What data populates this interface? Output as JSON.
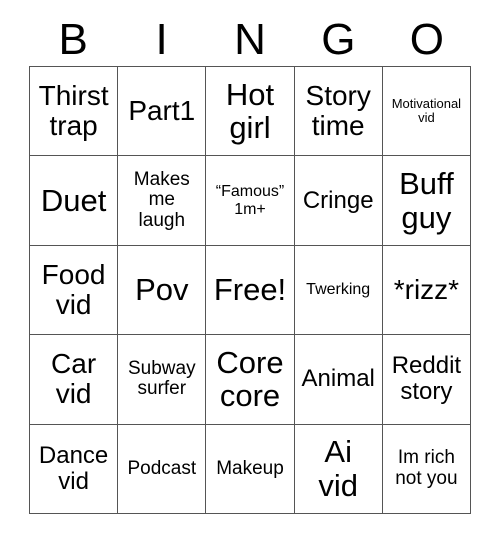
{
  "card": {
    "title": "BINGO",
    "header": {
      "letters": [
        "B",
        "I",
        "N",
        "G",
        "O"
      ]
    },
    "colors": {
      "background": "#ffffff",
      "text": "#000000",
      "gridline": "#555555"
    },
    "grid": {
      "rows": 5,
      "columns": 5,
      "free_space": {
        "row": 3,
        "column": 3,
        "label": "Free!"
      },
      "cells": [
        [
          {
            "label": "Thirst\ntrap",
            "size": "lg"
          },
          {
            "label": "Part1",
            "size": "lg"
          },
          {
            "label": "Hot\ngirl",
            "size": "xl"
          },
          {
            "label": "Story\ntime",
            "size": "lg"
          },
          {
            "label": "Motivational\nvid",
            "size": "xxs"
          }
        ],
        [
          {
            "label": "Duet",
            "size": "xl"
          },
          {
            "label": "Makes\nme\nlaugh",
            "size": "sm"
          },
          {
            "label": "“Famous”\n1m+",
            "size": "xs"
          },
          {
            "label": "Cringe",
            "size": "md"
          },
          {
            "label": "Buff\nguy",
            "size": "xl"
          }
        ],
        [
          {
            "label": "Food\nvid",
            "size": "lg"
          },
          {
            "label": "Pov",
            "size": "xl"
          },
          {
            "label": "Free!",
            "size": "xl"
          },
          {
            "label": "Twerking",
            "size": "xs"
          },
          {
            "label": "*rizz*",
            "size": "lg"
          }
        ],
        [
          {
            "label": "Car\nvid",
            "size": "lg"
          },
          {
            "label": "Subway\nsurfer",
            "size": "sm"
          },
          {
            "label": "Core\ncore",
            "size": "xl"
          },
          {
            "label": "Animal",
            "size": "md"
          },
          {
            "label": "Reddit\nstory",
            "size": "md"
          }
        ],
        [
          {
            "label": "Dance\nvid",
            "size": "md"
          },
          {
            "label": "Podcast",
            "size": "sm"
          },
          {
            "label": "Makeup",
            "size": "sm"
          },
          {
            "label": "Ai\nvid",
            "size": "xl"
          },
          {
            "label": "Im rich\nnot you",
            "size": "sm"
          }
        ]
      ]
    }
  }
}
